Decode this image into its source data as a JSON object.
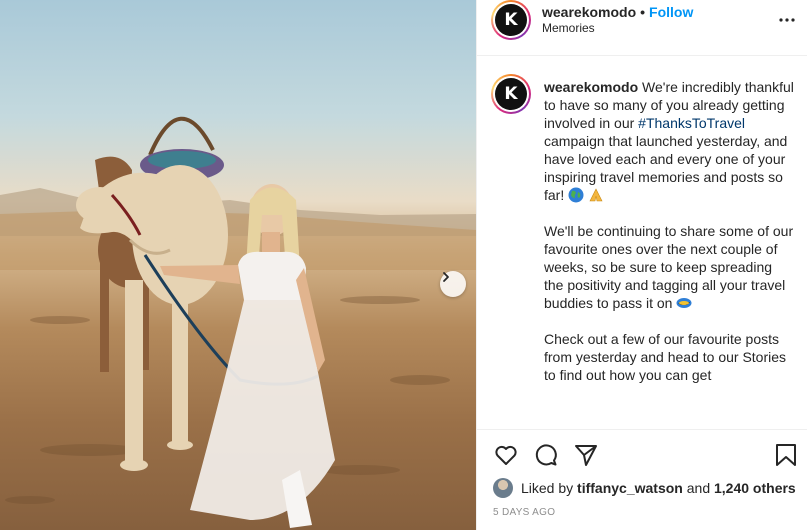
{
  "post": {
    "username": "wearekomodo",
    "separator": "•",
    "follow_label": "Follow",
    "location": "Memories",
    "avatar_letter": "K"
  },
  "caption": {
    "username": "wearekomodo",
    "p1_before": " We're incredibly thankful to have so many of you already getting involved in our ",
    "hashtag": "#ThanksToTravel",
    "p1_after": " campaign that launched yesterday, and have loved each and every one of your inspiring travel memories and posts so far!",
    "p2": "We'll be continuing to share some of our favourite ones over the next couple of weeks, so be sure to keep spreading the positivity and tagging all your travel buddies to pass it on",
    "p3": "Check out a few of our favourite posts from yesterday and head to our Stories to find out how you can get"
  },
  "likes": {
    "prefix": "Liked by",
    "user": "tiffanyc_watson",
    "joiner": "and",
    "others": "1,240 others"
  },
  "timestamp": "5 DAYS AGO",
  "icons": {
    "more": "more-options-icon",
    "like": "heart-icon",
    "comment": "comment-icon",
    "share": "share-icon",
    "save": "bookmark-icon",
    "next": "chevron-right-icon"
  },
  "colors": {
    "follow": "#0095f6",
    "hashtag": "#00376b",
    "text": "#262626",
    "muted": "#8e8e8e"
  }
}
